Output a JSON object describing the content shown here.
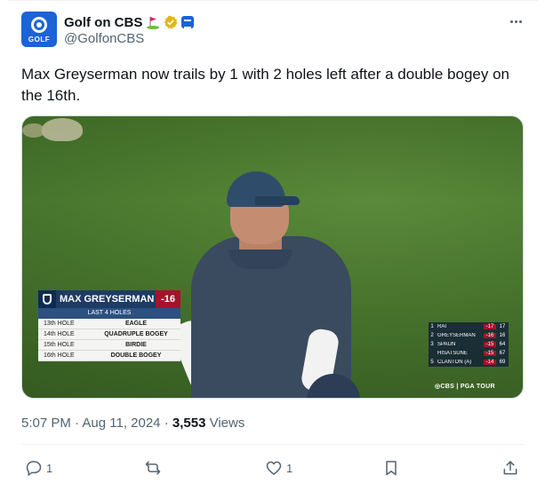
{
  "author": {
    "display_name": "Golf on CBS",
    "handle": "@GolfonCBS",
    "avatar_label": "GOLF",
    "badges": [
      "golf-flag-emoji",
      "verified-gold-icon",
      "affiliate-cbs-icon"
    ]
  },
  "tweet": {
    "text": "Max Greyserman now trails by 1 with 2 holes left after a double bogey on the 16th."
  },
  "media": {
    "lower_third": {
      "player_name": "MAX GREYSERMAN",
      "score": "-16",
      "subtitle": "LAST 4 HOLES",
      "rows": [
        {
          "hole": "13th HOLE",
          "result": "EAGLE"
        },
        {
          "hole": "14th HOLE",
          "result": "QUADRUPLE BOGEY"
        },
        {
          "hole": "15th HOLE",
          "result": "BIRDIE"
        },
        {
          "hole": "16th HOLE",
          "result": "DOUBLE BOGEY"
        }
      ]
    },
    "leaderboard": [
      {
        "pos": "1",
        "name": "RAI",
        "score": "-17",
        "thru": "17"
      },
      {
        "pos": "2",
        "name": "GREYSERMAN",
        "score": "-16",
        "thru": "16"
      },
      {
        "pos": "3",
        "name": "SPAUN",
        "score": "-15",
        "thru": "64"
      },
      {
        "pos": "",
        "name": "HISATSUNE",
        "score": "-15",
        "thru": "67"
      },
      {
        "pos": "5",
        "name": "CLANTON (A)",
        "score": "-14",
        "thru": "69"
      }
    ],
    "broadcast_logo": "◎CBS | PGA TOUR"
  },
  "meta": {
    "time": "5:07 PM",
    "separator": "·",
    "date": "Aug 11, 2024",
    "views_count": "3,553",
    "views_label": "Views"
  },
  "actions": {
    "reply_count": "1",
    "retweet_count": "",
    "like_count": "1"
  },
  "colors": {
    "text_primary": "#0f1419",
    "text_secondary": "#536471",
    "brand_blue": "#1b63d6",
    "verified_gold": "#e2b719",
    "score_red": "#a7122b",
    "graphic_navy": "#1e3c63"
  }
}
